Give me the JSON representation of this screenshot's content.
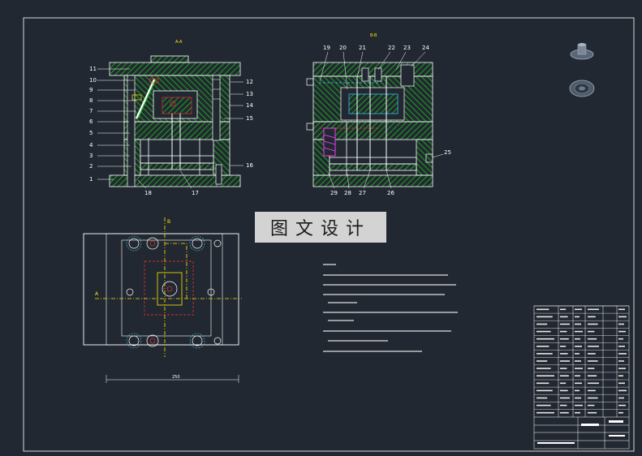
{
  "watermark": "图文设计",
  "views": {
    "section_a": {
      "title": "A-A"
    },
    "section_b": {
      "title": "B-B"
    }
  },
  "callouts_left": [
    "11",
    "10",
    "9",
    "8",
    "7",
    "6",
    "5",
    "4",
    "3",
    "2",
    "1"
  ],
  "callouts_right_a": [
    "12",
    "13",
    "14",
    "15",
    "16"
  ],
  "callouts_bottom_a": [
    "18",
    "17"
  ],
  "callouts_top_b": [
    "19",
    "20",
    "21",
    "22",
    "23",
    "24"
  ],
  "callouts_right_b": [
    "25"
  ],
  "callouts_bottom_b": [
    "29",
    "28",
    "27",
    "26"
  ],
  "plan_labels": {
    "section_mark_a": "A",
    "section_mark_b": "B",
    "overall_dim": "250"
  },
  "colors": {
    "background": "#222831",
    "outline": "#ffffff",
    "hatch": "#19c219",
    "accent_red": "#ff3030",
    "accent_yellow": "#ffe600",
    "accent_cyan": "#3fd0ff",
    "accent_magenta": "#ff40ff"
  }
}
